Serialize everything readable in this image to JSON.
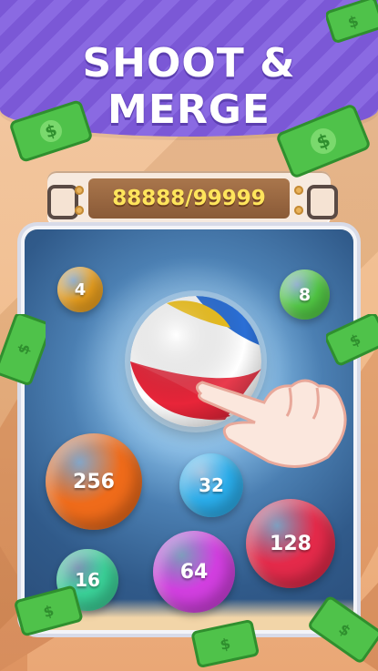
{
  "header": {
    "title": "SHOOT & MERGE"
  },
  "score_bar": {
    "text": "88888/99999"
  },
  "board": {
    "balls": [
      {
        "label": "4",
        "color": "#f2a51f"
      },
      {
        "label": "8",
        "color": "#55d047"
      },
      {
        "label": "256",
        "color": "#ef6b1a"
      },
      {
        "label": "32",
        "color": "#2bb0ef"
      },
      {
        "label": "128",
        "color": "#e42a4a"
      },
      {
        "label": "16",
        "color": "#3bd49a"
      },
      {
        "label": "64",
        "color": "#d23fe0"
      }
    ],
    "shooter": {
      "icon": "beach-ball-icon",
      "colors": [
        "#e8263a",
        "#ffffff",
        "#f5c518",
        "#2b6fd6"
      ]
    }
  },
  "decor": {
    "money_icon": "dollar-bill-icon",
    "money_symbol": "$",
    "money_color": "#4fc24a",
    "hand_icon": "pointing-hand-icon"
  },
  "colors": {
    "banner": "#7b58d6",
    "score_text": "#ffe55c",
    "board_blue": "#305a8a"
  }
}
